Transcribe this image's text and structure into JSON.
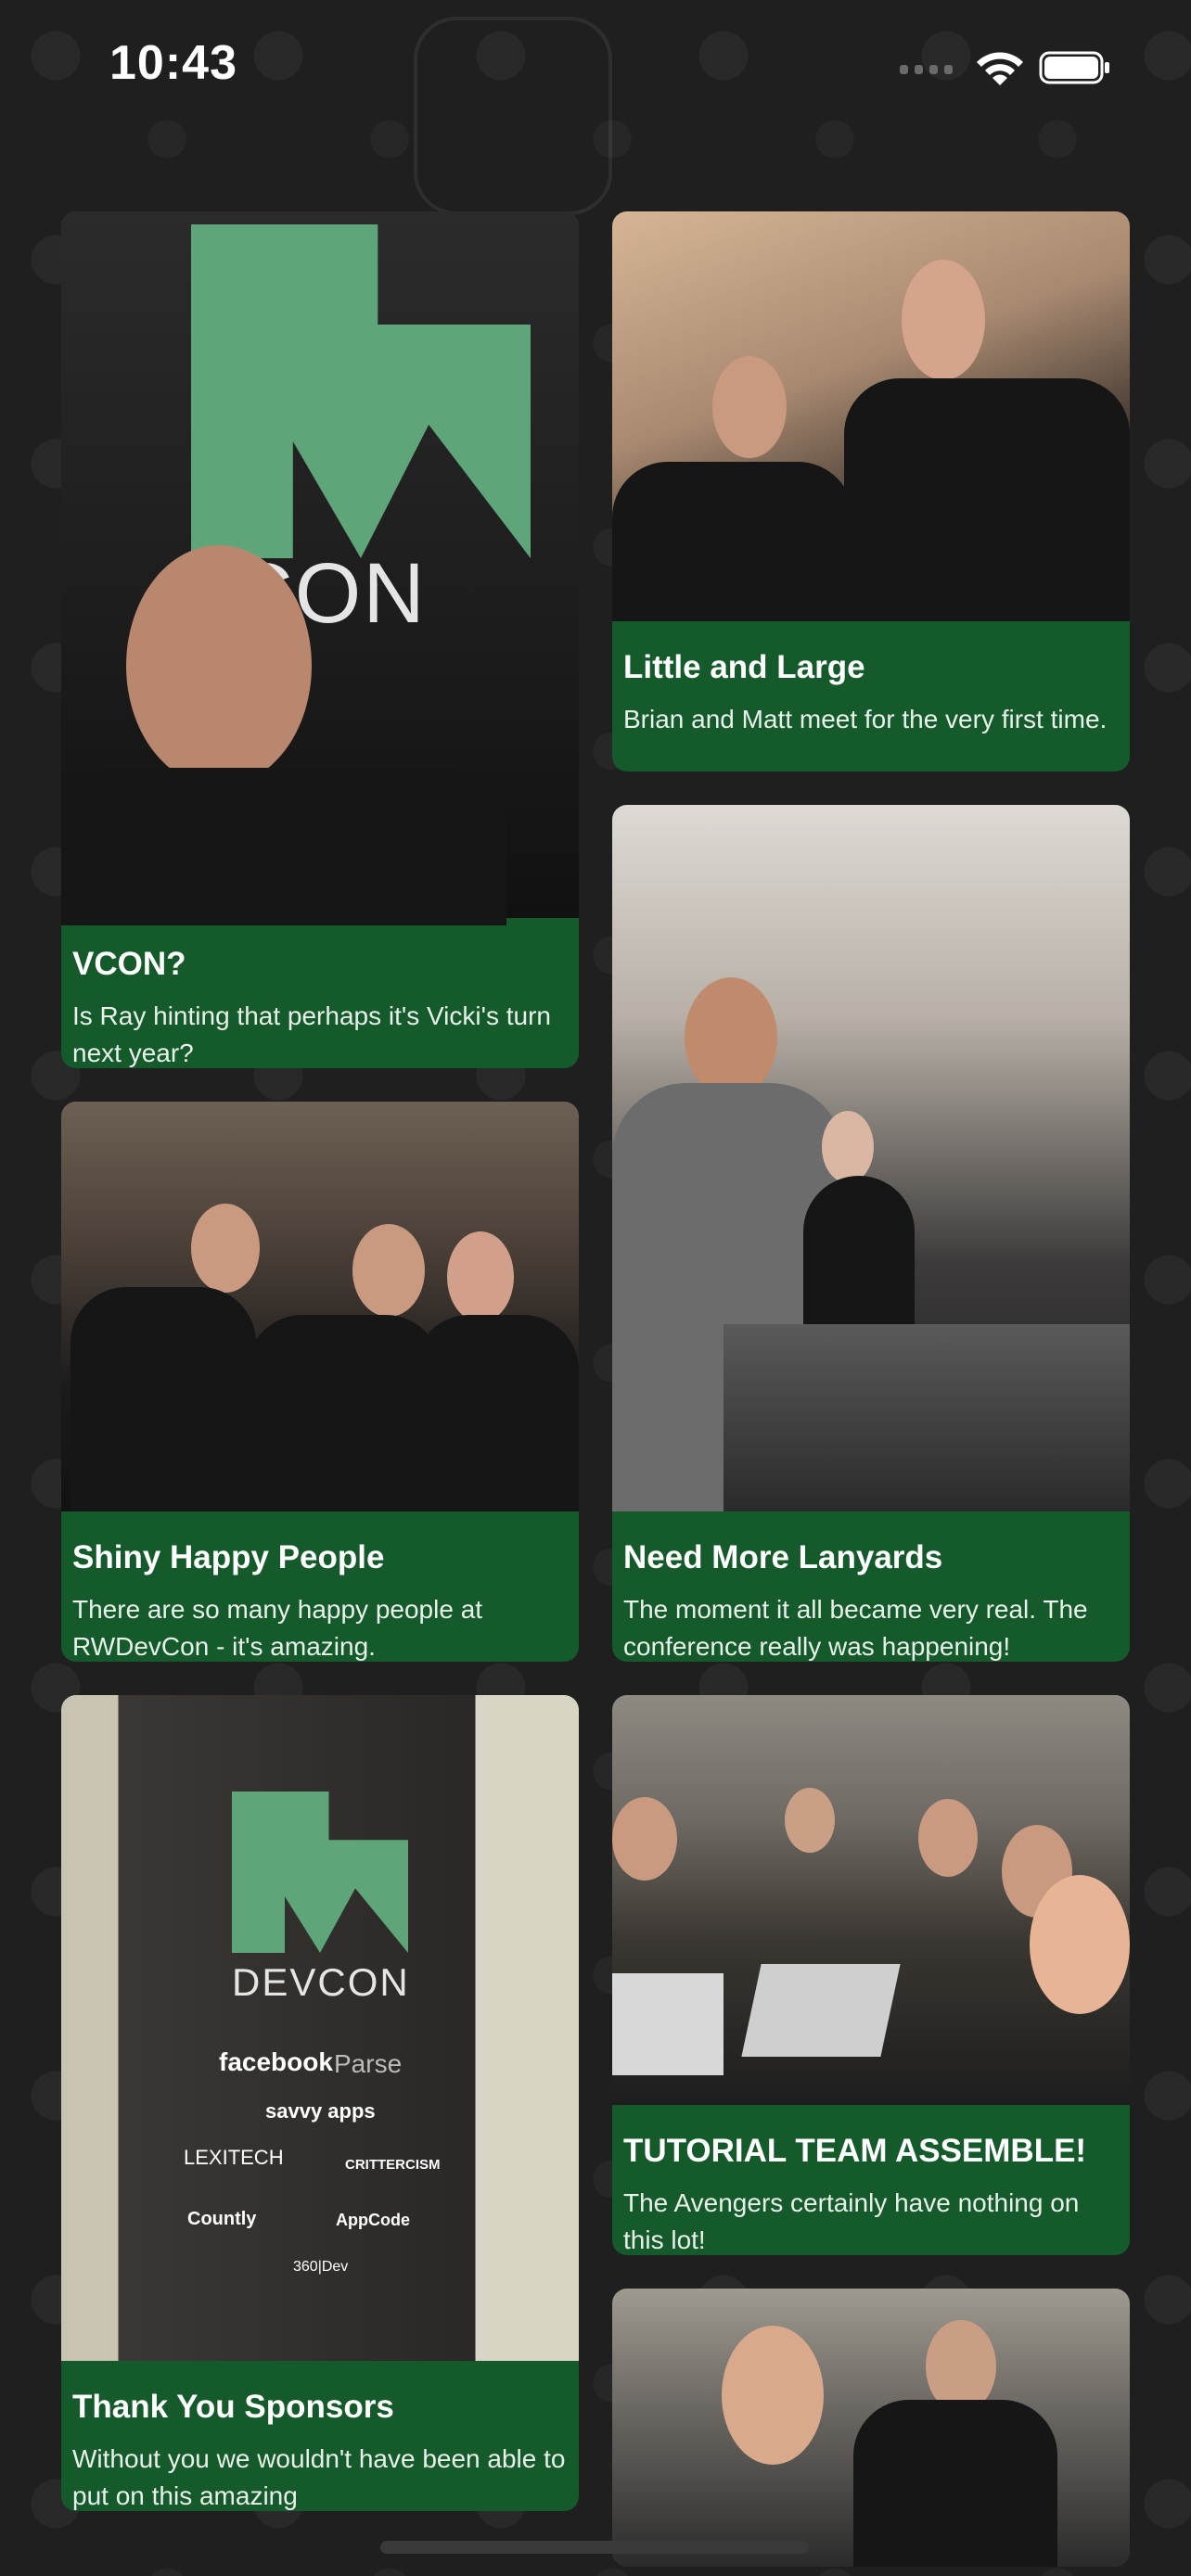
{
  "status_bar": {
    "time": "10:43"
  },
  "cards": [
    {
      "title": "VCON?",
      "description": "Is Ray hinting that perhaps it's Vicki's turn next year?",
      "photo_text": "VCON"
    },
    {
      "title": "Little and Large",
      "description": "Brian and Matt meet for the very first time."
    },
    {
      "title": "Shiny Happy People",
      "description": "There are so many happy people at RWDevCon - it's amazing."
    },
    {
      "title": "Need More Lanyards",
      "description": "The moment it all became very real. The conference really was happening!"
    },
    {
      "title": "Thank You Sponsors",
      "description": "Without you we wouldn't have been able to put on this amazing",
      "photo_text": "DEVCON",
      "sponsors": [
        "facebook",
        "Parse",
        "savvy apps",
        "LEXITECH",
        "CRITTERCISM",
        "Countly",
        "AppCode",
        "360|Dev"
      ]
    },
    {
      "title": "TUTORIAL TEAM ASSEMBLE!",
      "description": "The Avengers certainly have nothing on this lot!"
    }
  ],
  "colors": {
    "background": "#1f1f1f",
    "card_green": "#145a2b",
    "logo_green": "#5fa57a"
  },
  "icons": {
    "wifi": "wifi-icon",
    "battery": "battery-icon",
    "signal": "cellular-signal-icon"
  }
}
